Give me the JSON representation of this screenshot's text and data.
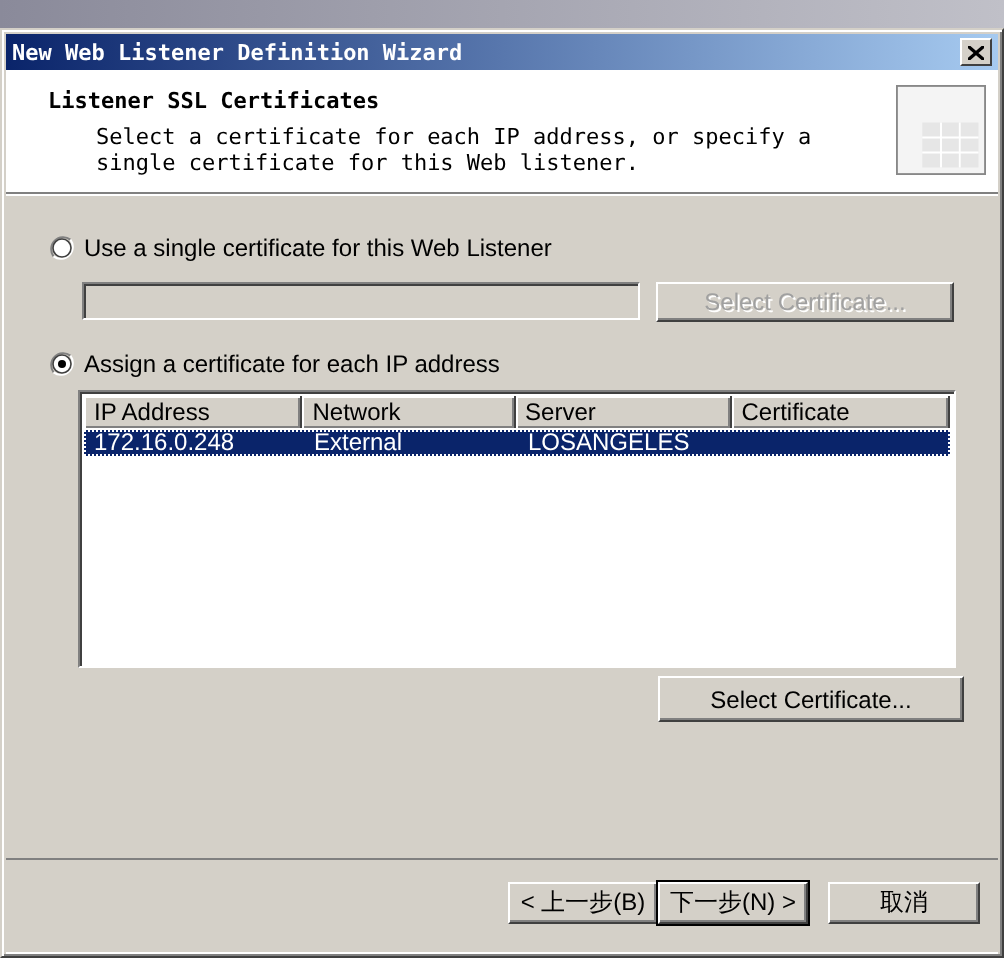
{
  "window": {
    "title": "New Web Listener Definition Wizard"
  },
  "header": {
    "title": "Listener SSL Certificates",
    "description": "Select a certificate for each IP address, or specify a single certificate for this Web listener."
  },
  "options": [
    {
      "kind": "single",
      "label": "Use a single certificate for this Web Listener",
      "selected": false,
      "field": {
        "disabled": true
      },
      "button": {
        "label": "Select Certificate...",
        "disabled": true
      }
    },
    {
      "kind": "per_ip",
      "label": "Assign a certificate for each IP address",
      "selected": true,
      "table": {
        "columns": [
          "IP Address",
          "Network",
          "Server",
          "Certificate"
        ],
        "rows": [
          {
            "cells": [
              "172.16.0.248",
              "External",
              "LOSANGELES"
            ],
            "selected": true
          }
        ]
      },
      "button": {
        "label": "Select Certificate...",
        "disabled": false
      }
    }
  ],
  "buttons": [
    {
      "label": "< 上一步(B)",
      "default": false
    },
    {
      "label": "下一步(N) >",
      "default": true
    },
    {
      "label": "取消",
      "default": false
    }
  ]
}
